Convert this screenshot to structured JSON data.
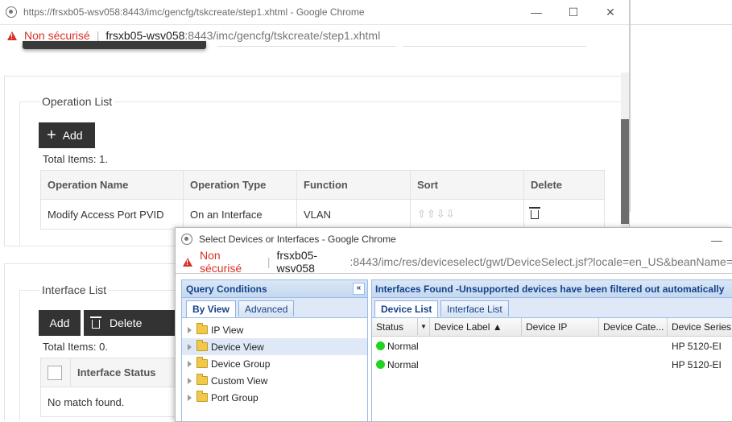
{
  "main_window": {
    "title": "https://frsxb05-wsv058:8443/imc/gencfg/tskcreate/step1.xhtml - Google Chrome",
    "insecure_label": "Non sécurisé",
    "url_host": "frsxb05-wsv058",
    "url_rest": ":8443/imc/gencfg/tskcreate/step1.xhtml",
    "controls": {
      "minimize": "—",
      "maximize": "☐",
      "close": "✕"
    }
  },
  "operation_list": {
    "legend": "Operation List",
    "add_label": "Add",
    "total": "Total Items: 1.",
    "columns": [
      "Operation Name",
      "Operation Type",
      "Function",
      "Sort",
      "Delete"
    ],
    "rows": [
      {
        "name": "Modify Access Port PVID",
        "type": "On an Interface",
        "function": "VLAN",
        "sort": "⇧⇧⇩⇩"
      }
    ]
  },
  "interface_list": {
    "legend": "Interface List",
    "add_label": "Add",
    "delete_label": "Delete",
    "total": "Total Items: 0.",
    "columns": [
      "Interface Status"
    ],
    "empty_text": "No match found."
  },
  "popup_window": {
    "title": "Select Devices or Interfaces - Google Chrome",
    "insecure_label": "Non sécurisé",
    "url_host": "frsxb05-wsv058",
    "url_rest": ":8443/imc/res/deviceselect/gwt/DeviceSelect.jsf?locale=en_US&beanName=",
    "minimize": "—"
  },
  "query_conditions": {
    "header": "Query Conditions",
    "collapse": "«",
    "tabs": [
      "By View",
      "Advanced"
    ],
    "tree": [
      "IP View",
      "Device View",
      "Device Group",
      "Custom View",
      "Port Group"
    ]
  },
  "interfaces_found": {
    "header": "Interfaces Found -Unsupported devices have been filtered out automatically",
    "tabs": [
      "Device List",
      "Interface List"
    ],
    "columns": [
      "Status",
      "Device Label ▲",
      "Device IP",
      "Device Cate...",
      "Device Series"
    ],
    "rows": [
      {
        "status": "Normal",
        "series": "HP 5120-EI"
      },
      {
        "status": "Normal",
        "series": "HP 5120-EI"
      }
    ]
  },
  "colors": {
    "insecure": "#d93025",
    "dark_button": "#333333",
    "panel_header": "#15428b",
    "status_ok": "#22d422"
  }
}
